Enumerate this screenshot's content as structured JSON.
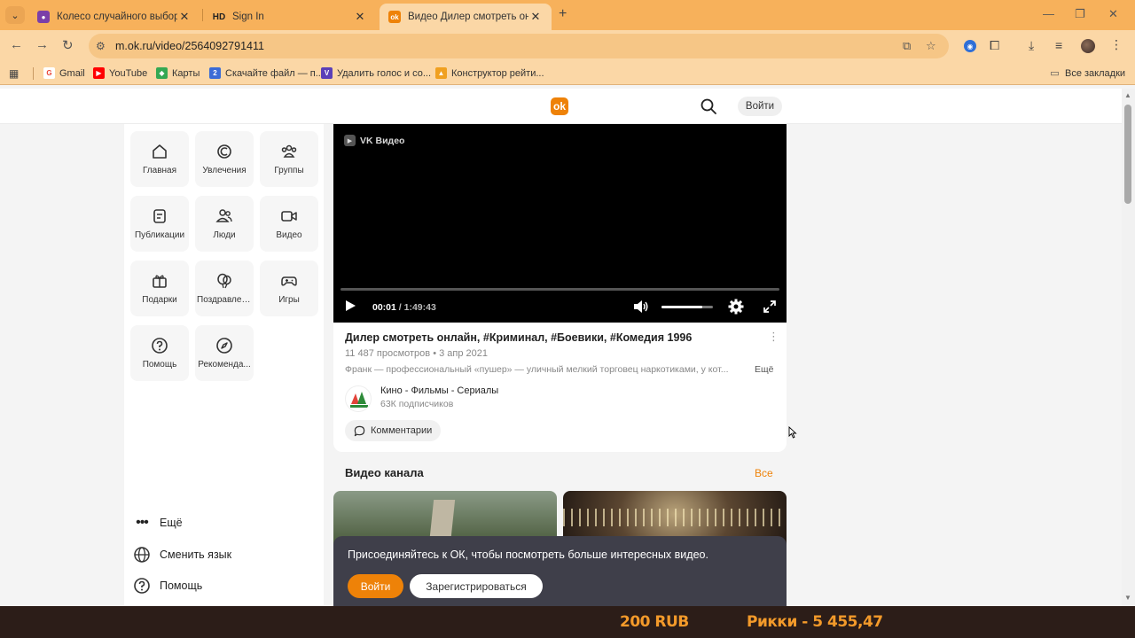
{
  "browser": {
    "tabs": [
      {
        "title": "Колесо случайного выбора - ",
        "favicon_color": "#7b3fa8",
        "favicon_text": "●"
      },
      {
        "title": "Sign In",
        "favicon_color": "#333333",
        "favicon_text": "HD"
      },
      {
        "title": "Видео Дилер смотреть онлайн",
        "favicon_color": "#ee8208",
        "favicon_text": "ok"
      }
    ],
    "url": "m.ok.ru/video/2564092791411",
    "bookmarks": [
      {
        "label": "Gmail",
        "color": "#ea4335",
        "text": "G"
      },
      {
        "label": "YouTube",
        "color": "#ff0000",
        "text": "▶"
      },
      {
        "label": "Карты",
        "color": "#34a853",
        "text": "◆"
      },
      {
        "label": "Скачайте файл — п...",
        "color": "#3b6bd6",
        "text": "2"
      },
      {
        "label": "Удалить голос и со...",
        "color": "#5a3fb8",
        "text": "V"
      },
      {
        "label": "Конструктор рейти...",
        "color": "#f0a020",
        "text": "▲"
      }
    ],
    "all_bookmarks": "Все закладки"
  },
  "header": {
    "login": "Войти"
  },
  "nav": {
    "tiles": [
      {
        "label": "Главная",
        "icon": "home-icon"
      },
      {
        "label": "Увлечения",
        "icon": "hobby-icon"
      },
      {
        "label": "Группы",
        "icon": "groups-icon"
      },
      {
        "label": "Публикации",
        "icon": "posts-icon"
      },
      {
        "label": "Люди",
        "icon": "people-icon"
      },
      {
        "label": "Видео",
        "icon": "video-icon"
      },
      {
        "label": "Подарки",
        "icon": "gift-icon"
      },
      {
        "label": "Поздравлен...",
        "icon": "balloons-icon"
      },
      {
        "label": "Игры",
        "icon": "gamepad-icon"
      },
      {
        "label": "Помощь",
        "icon": "help-icon"
      },
      {
        "label": "Рекоменда...",
        "icon": "compass-icon"
      }
    ],
    "more": "Ещё",
    "language": "Сменить язык",
    "help": "Помощь"
  },
  "player": {
    "badge": "VK Видео",
    "current": "00:01",
    "duration": "1:49:43",
    "progress": 0.0,
    "volume": 0.8
  },
  "video": {
    "title": "Дилер смотреть онлайн, #Криминал, #Боевики, #Комедия 1996",
    "views": "11 487 просмотров",
    "date": "3 апр 2021",
    "meta_sep": "•",
    "description": "Франк — профессиональный «пушер» — уличный мелкий торговец наркотиками, у кот...",
    "desc_more": "Ещё",
    "channel_name": "Кино - Фильмы - Сериалы",
    "channel_subs": "63К подписчиков",
    "comments": "Комментарии"
  },
  "channel_videos": {
    "title": "Видео канала",
    "all": "Все"
  },
  "join": {
    "text": "Присоединяйтесь к ОК, чтобы посмотреть больше интересных видео.",
    "login": "Войти",
    "register": "Зарегистрироваться"
  },
  "overlay": {
    "amount": "200 RUB",
    "donor": "Рикки - 5 455,47"
  },
  "colors": {
    "accent": "#ee8208",
    "tabstrip": "#f7b15b",
    "toolbar": "#fbd7a6"
  }
}
